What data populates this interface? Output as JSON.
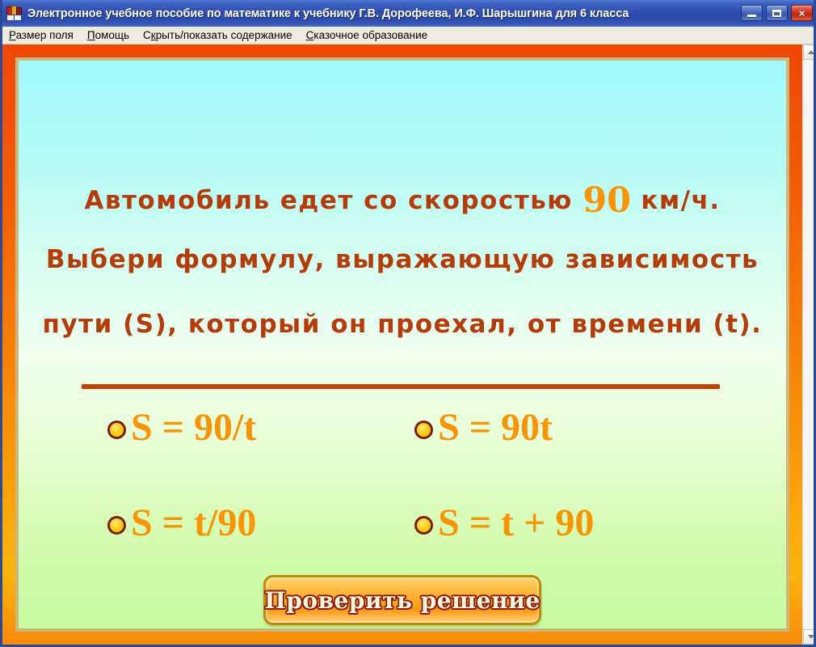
{
  "window": {
    "title": "Электронное учебное пособие по математике к учебнику Г.В. Дорофеева, И.Ф. Шарышгина для 6 класса",
    "icon": "books-icon",
    "controls": {
      "minimize": "minimize-icon",
      "maximize": "maximize-icon",
      "close": "×"
    }
  },
  "menu": {
    "items": [
      {
        "accel": "Р",
        "rest": "азмер поля"
      },
      {
        "accel": "П",
        "rest": "омощь"
      },
      {
        "accel": "к",
        "pre": "С",
        "rest": "рыть/показать содержание"
      },
      {
        "accel": "С",
        "rest": "казочное образование"
      }
    ]
  },
  "lesson": {
    "question": {
      "line1_before": "Автомобиль  едет  со  скоростью",
      "speed_value": "90",
      "line1_after": "км/ч.",
      "line2": "Выбери  формулу,  выражающую  зависимость",
      "line3": "пути (S), который он проехал, от времени (t)."
    },
    "options": [
      {
        "id": "opt-1",
        "label": "S = 90/t",
        "selected": false
      },
      {
        "id": "opt-2",
        "label": "S = 90t",
        "selected": false
      },
      {
        "id": "opt-3",
        "label": "S = t/90",
        "selected": false
      },
      {
        "id": "opt-4",
        "label": "S = t + 90",
        "selected": false
      }
    ],
    "check_button": "Проверить решение"
  },
  "scrollbar": {
    "up_arrow": "chevron-up-icon",
    "down_arrow": "chevron-down-icon"
  },
  "colors": {
    "title_bar": "#2f4eb0",
    "frame_orange": "#f87f08",
    "question_text": "#b43c0a",
    "accent_orange": "#f89406",
    "radio_fill": "#ffd21e",
    "radio_border": "#7d1d12",
    "divider": "#c4420a"
  }
}
